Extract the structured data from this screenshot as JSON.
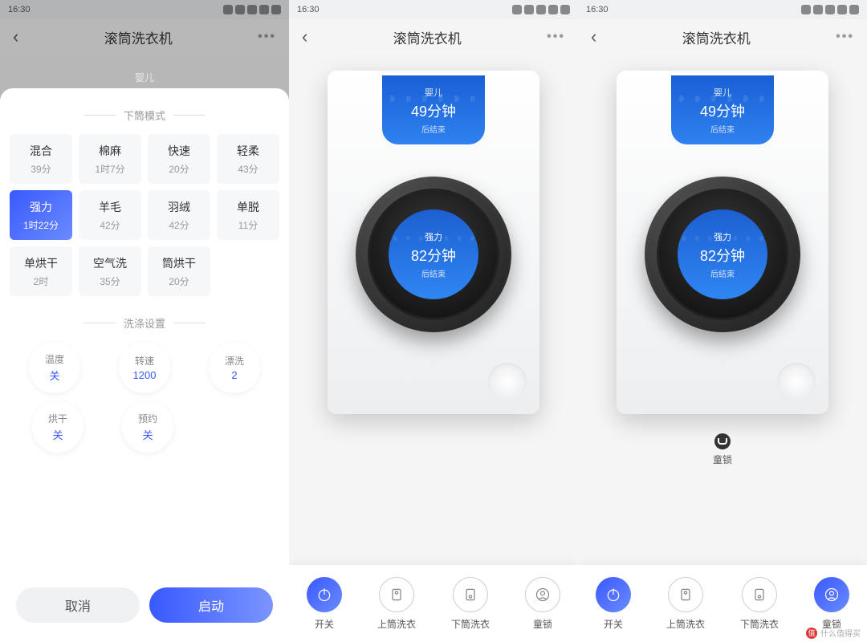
{
  "statusbar": {
    "time": "16:30"
  },
  "header": {
    "title": "滚筒洗衣机"
  },
  "sheet": {
    "section_modes": "下筒模式",
    "modes": [
      {
        "name": "混合",
        "time": "39分"
      },
      {
        "name": "棉麻",
        "time": "1时7分"
      },
      {
        "name": "快速",
        "time": "20分"
      },
      {
        "name": "轻柔",
        "time": "43分"
      },
      {
        "name": "强力",
        "time": "1时22分"
      },
      {
        "name": "羊毛",
        "time": "42分"
      },
      {
        "name": "羽绒",
        "time": "42分"
      },
      {
        "name": "单脱",
        "time": "11分"
      },
      {
        "name": "单烘干",
        "time": "2时"
      },
      {
        "name": "空气洗",
        "time": "35分"
      },
      {
        "name": "筒烘干",
        "time": "20分"
      }
    ],
    "selected_index": 4,
    "section_wash": "洗涤设置",
    "wash": [
      {
        "label": "温度",
        "value": "关"
      },
      {
        "label": "转速",
        "value": "1200"
      },
      {
        "label": "漂洗",
        "value": "2"
      },
      {
        "label": "烘干",
        "value": "关"
      },
      {
        "label": "预约",
        "value": "关"
      }
    ],
    "cancel": "取消",
    "start": "启动"
  },
  "device": {
    "top": {
      "mode": "婴儿",
      "duration": "49分钟",
      "sub": "后结束"
    },
    "main": {
      "mode": "强力",
      "duration": "82分钟",
      "sub": "后结束"
    }
  },
  "child_lock": {
    "label": "童锁"
  },
  "nav": {
    "items": [
      {
        "label": "开关",
        "icon": "power"
      },
      {
        "label": "上筒洗衣",
        "icon": "top-drum"
      },
      {
        "label": "下筒洗衣",
        "icon": "bottom-drum"
      },
      {
        "label": "童锁",
        "icon": "lock"
      }
    ]
  },
  "watermark": "什么值得买"
}
